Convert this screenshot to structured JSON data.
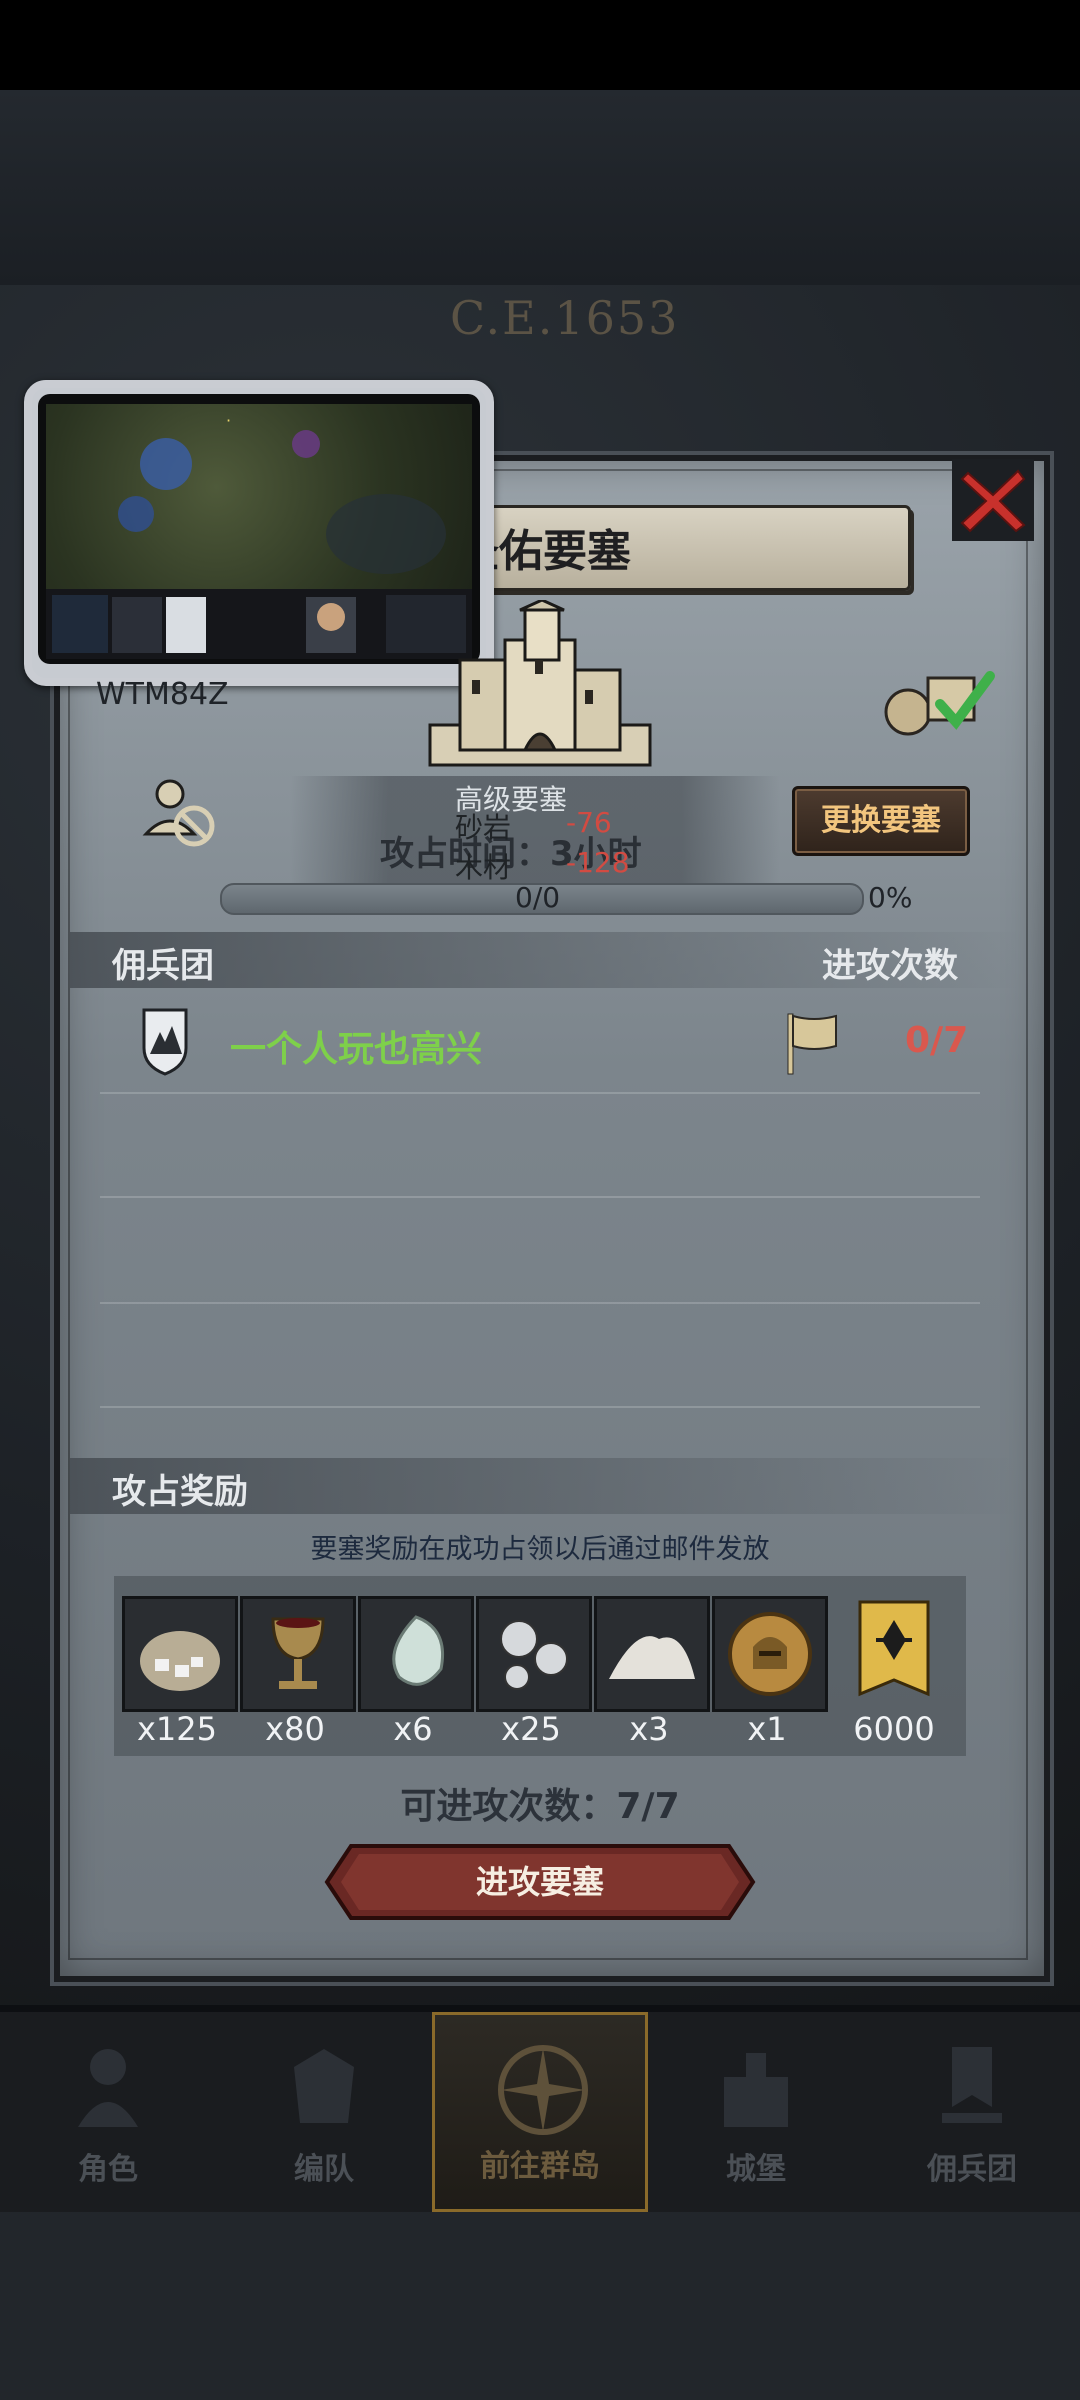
{
  "background": {
    "year": "C.E.1653"
  },
  "overlay": {
    "player_id": "WTM84Z"
  },
  "dialog": {
    "title": "圣佑要塞",
    "fortress_level": "高级要塞",
    "occupy_time": "攻占时间：3小时",
    "costs": [
      {
        "name": "砂岩",
        "value": "-76"
      },
      {
        "name": "木材",
        "value": "-128"
      }
    ],
    "change_button": "更换要塞",
    "progress": {
      "text": "0/0",
      "percent": "0%",
      "fraction": 0
    }
  },
  "mercenary": {
    "header_left": "佣兵团",
    "header_right": "进攻次数",
    "rows": [
      {
        "name": "一个人玩也高兴",
        "count": "0/7"
      }
    ]
  },
  "rewards": {
    "header": "攻占奖励",
    "note": "要塞奖励在成功占领以后通过邮件发放",
    "items": [
      {
        "icon": "ore-bag-icon",
        "qty": "x125"
      },
      {
        "icon": "goblet-icon",
        "qty": "x80"
      },
      {
        "icon": "gem-icon",
        "qty": "x6"
      },
      {
        "icon": "silver-coins-icon",
        "qty": "x25"
      },
      {
        "icon": "salt-pile-icon",
        "qty": "x3"
      },
      {
        "icon": "helmet-medal-icon",
        "qty": "x1"
      },
      {
        "icon": "rank-banner-icon",
        "qty": "6000"
      }
    ],
    "attack_times": "可进攻次数：7/7",
    "attack_button": "进攻要塞"
  },
  "nav": [
    {
      "label": "角色",
      "icon": "knight-icon"
    },
    {
      "label": "编队",
      "icon": "armor-icon"
    },
    {
      "label": "前往群岛",
      "icon": "compass-icon",
      "active": true
    },
    {
      "label": "城堡",
      "icon": "castle-icon"
    },
    {
      "label": "佣兵团",
      "icon": "banner-icon"
    }
  ],
  "colors": {
    "accent_gold": "#f2c57e",
    "merc_green": "#7ed04a",
    "cost_red": "#d24b42"
  }
}
